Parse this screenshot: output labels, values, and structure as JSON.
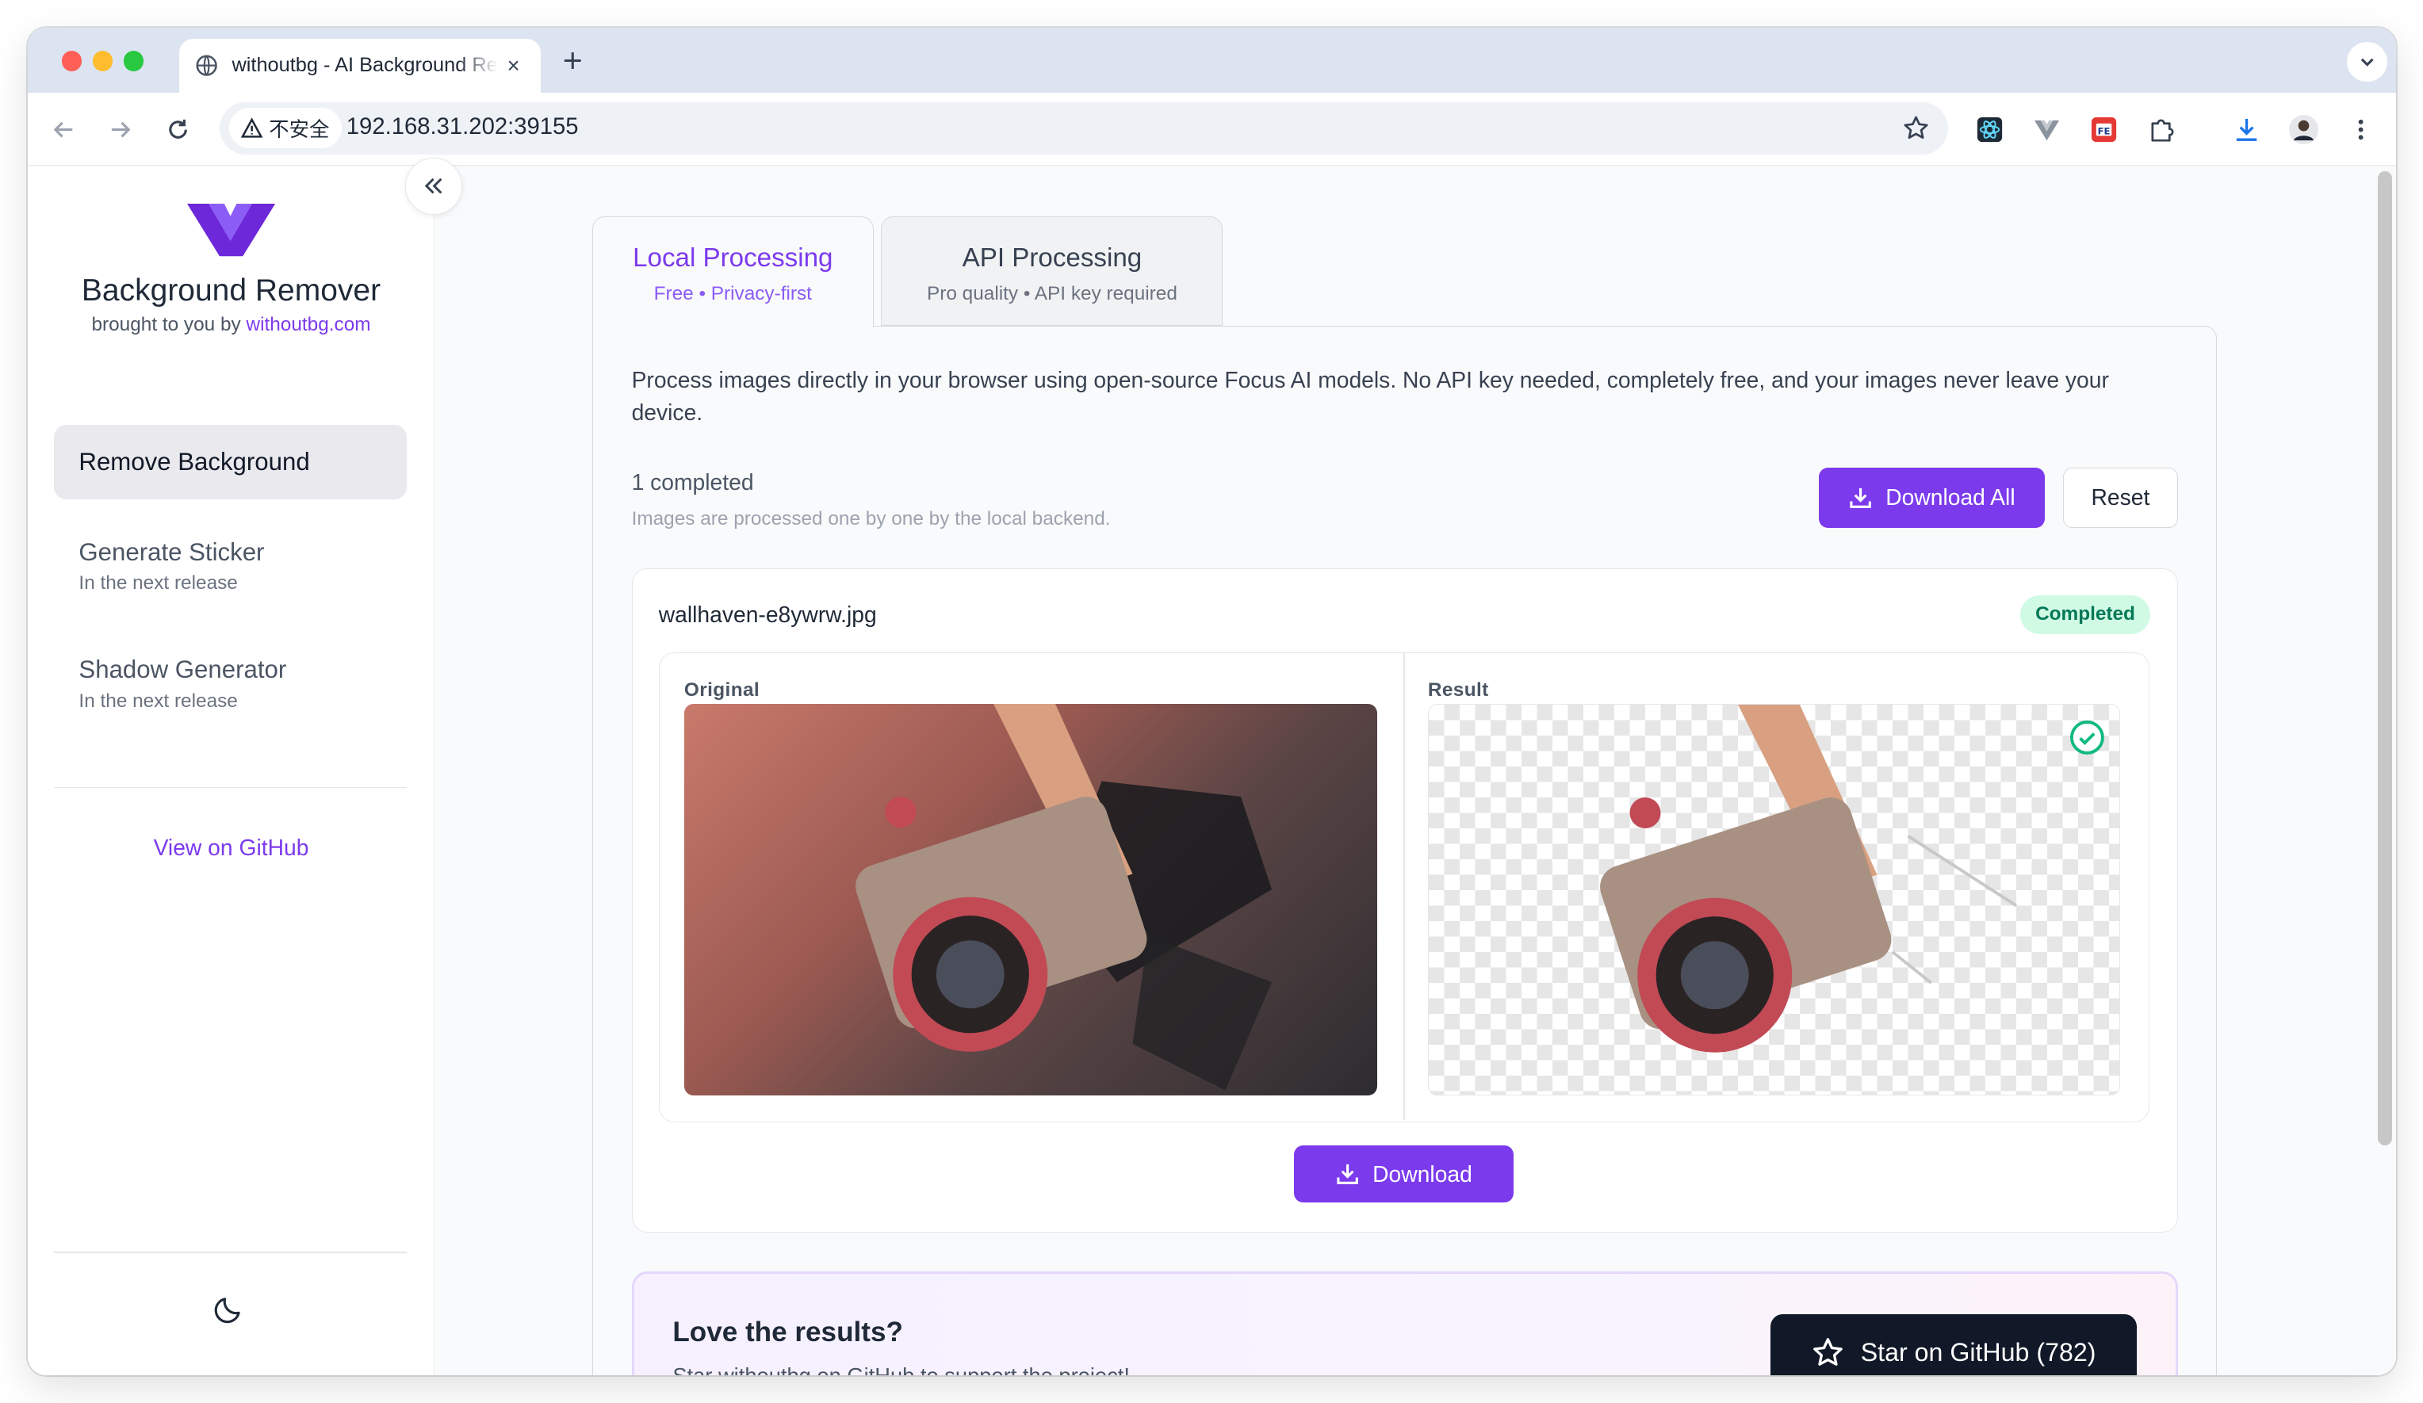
{
  "browser": {
    "tab_title": "withoutbg - AI Background Remover",
    "new_tab": "+",
    "close_tab": "×",
    "security_label": "不安全",
    "url": "192.168.31.202:39155"
  },
  "sidebar": {
    "brand": "Background Remover",
    "byline_prefix": "brought to you by ",
    "byline_link": "withoutbg.com",
    "nav": [
      {
        "label": "Remove Background"
      },
      {
        "label": "Generate Sticker",
        "sub": "In the next release"
      },
      {
        "label": "Shadow Generator",
        "sub": "In the next release"
      }
    ],
    "github_link": "View on GitHub"
  },
  "main": {
    "tabs": [
      {
        "label": "Local Processing",
        "desc": "Free • Privacy-first"
      },
      {
        "label": "API Processing",
        "desc": "Pro quality • API key required"
      }
    ],
    "intro": "Process images directly in your browser using open-source Focus AI models. No API key needed, completely free, and your images never leave your device.",
    "count": "1 completed",
    "count_sub": "Images are processed one by one by the local backend.",
    "download_all": "Download All",
    "reset": "Reset",
    "item": {
      "filename": "wallhaven-e8ywrw.jpg",
      "status": "Completed",
      "original_label": "Original",
      "result_label": "Result",
      "download": "Download"
    },
    "promo": {
      "title": "Love the results?",
      "subtitle": "Star withoutbg on GitHub to support the project!",
      "star_button": "Star on GitHub (782)"
    }
  },
  "colors": {
    "accent": "#7c3aed",
    "success_bg": "#d1fae5",
    "success_text": "#047857"
  }
}
